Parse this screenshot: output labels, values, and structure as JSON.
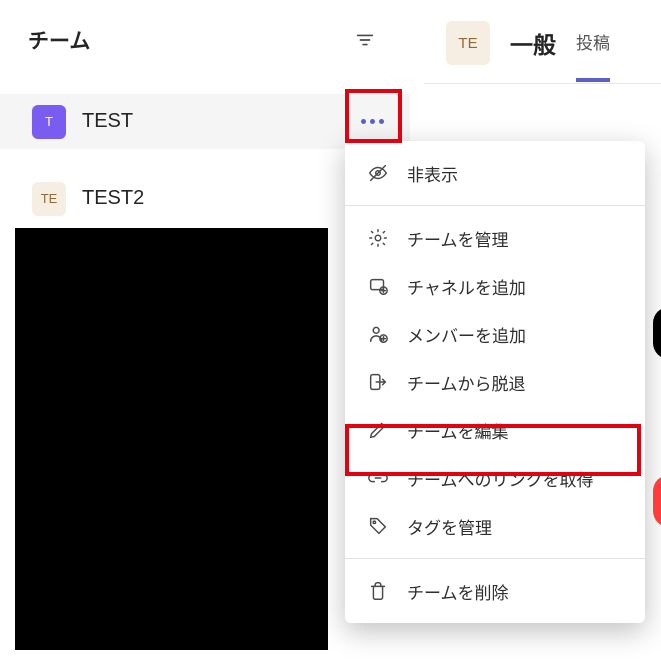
{
  "sidebar": {
    "title": "チーム",
    "teams": [
      {
        "name": "TEST",
        "initials": "T",
        "avatar_style": "purple",
        "active": true
      },
      {
        "name": "TEST2",
        "initials": "TE",
        "avatar_style": "cream",
        "active": false
      }
    ]
  },
  "right_header": {
    "avatar_initials": "TE",
    "channel": "一般",
    "tabs": [
      {
        "label": "投稿",
        "active": true
      }
    ]
  },
  "context_menu": {
    "items": [
      {
        "icon": "hide",
        "label": "非表示"
      },
      null,
      {
        "icon": "gear",
        "label": "チームを管理"
      },
      {
        "icon": "channel",
        "label": "チャネルを追加"
      },
      {
        "icon": "adduser",
        "label": "メンバーを追加"
      },
      {
        "icon": "leave",
        "label": "チームから脱退"
      },
      {
        "icon": "edit",
        "label": "チームを編集"
      },
      {
        "icon": "link",
        "label": "チームへのリンクを取得"
      },
      {
        "icon": "tag",
        "label": "タグを管理"
      },
      null,
      {
        "icon": "trash",
        "label": "チームを削除"
      }
    ]
  }
}
